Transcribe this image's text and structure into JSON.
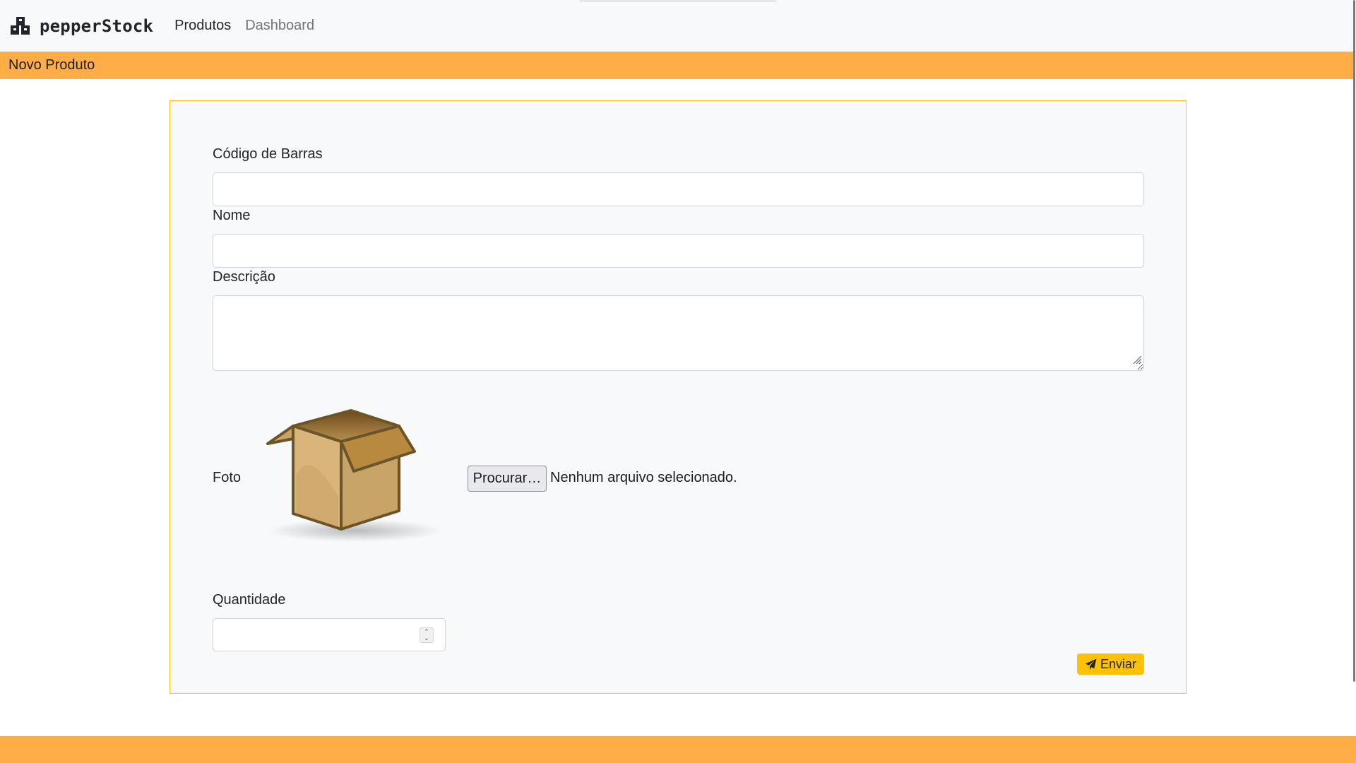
{
  "navbar": {
    "brand": "pepperStock",
    "brand_icon": "boxes-icon",
    "links": [
      {
        "label": "Produtos",
        "active": true
      },
      {
        "label": "Dashboard",
        "active": false
      }
    ]
  },
  "header": {
    "title": "Novo Produto"
  },
  "form": {
    "barcode": {
      "label": "Código de Barras",
      "value": ""
    },
    "name": {
      "label": "Nome",
      "value": ""
    },
    "description": {
      "label": "Descrição",
      "value": ""
    },
    "photo": {
      "label": "Foto",
      "placeholder_icon": "open-box-icon",
      "browse_label": "Procurar…",
      "file_status": "Nenhum arquivo selecionado."
    },
    "quantity": {
      "label": "Quantidade",
      "value": ""
    },
    "submit": {
      "label": "Enviar",
      "icon": "paper-plane-icon"
    }
  },
  "colors": {
    "accent_orange": "#ffad47",
    "warning_yellow": "#ffc107",
    "navbar_bg": "#f8f9fa"
  }
}
